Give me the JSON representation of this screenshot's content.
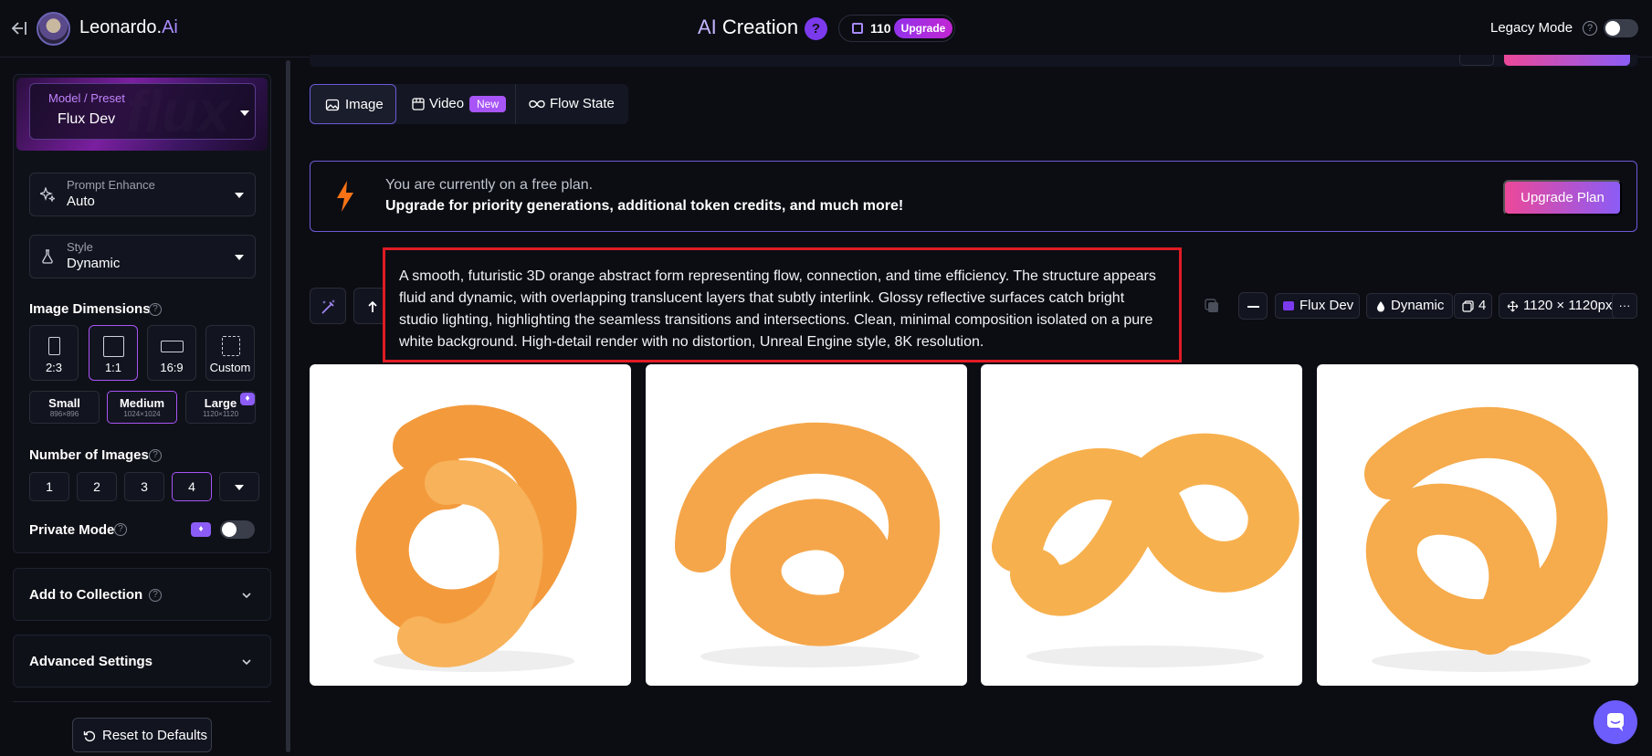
{
  "header": {
    "brand_name": "Leonardo.",
    "brand_ai": "Ai",
    "title_ai": "AI",
    "title_rest": " Creation",
    "help": "?",
    "token_count": "110",
    "upgrade_label": "Upgrade",
    "legacy_mode_label": "Legacy Mode",
    "legacy_help": "?"
  },
  "sidebar": {
    "model_label": "Model / Preset",
    "model_value": "Flux Dev",
    "model_ghost": "flux",
    "prompt_enhance_label": "Prompt Enhance",
    "prompt_enhance_value": "Auto",
    "style_label": "Style",
    "style_value": "Dynamic",
    "image_dimensions_title": "Image Dimensions",
    "help": "?",
    "ratios": [
      {
        "label": "2:3"
      },
      {
        "label": "1:1"
      },
      {
        "label": "16:9"
      },
      {
        "label": "Custom"
      }
    ],
    "sizes": [
      {
        "name": "Small",
        "dim": "896×896"
      },
      {
        "name": "Medium",
        "dim": "1024×1024"
      },
      {
        "name": "Large",
        "dim": "1120×1120"
      }
    ],
    "number_of_images_title": "Number of Images",
    "numbers": [
      "1",
      "2",
      "3",
      "4"
    ],
    "private_mode_label": "Private Mode",
    "add_to_collection_label": "Add to Collection",
    "advanced_settings_label": "Advanced Settings",
    "reset_label": "Reset to Defaults"
  },
  "tabs": {
    "image": "Image",
    "video": "Video",
    "video_badge": "New",
    "flow_state": "Flow State"
  },
  "banner": {
    "line1": "You are currently on a free plan.",
    "line2": "Upgrade for priority generations, additional token credits, and much more!",
    "button": "Upgrade Plan"
  },
  "generation": {
    "prompt": "A smooth, futuristic 3D orange abstract form representing flow, connection, and time efficiency. The structure appears fluid and dynamic, with overlapping translucent layers that subtly interlink. Glossy reflective surfaces catch bright studio lighting, highlighting the seamless transitions and intersections. Clean, minimal composition isolated on a pure white background. High-detail render with no distortion, Unreal Engine style, 8K resolution.",
    "chip_model": "Flux Dev",
    "chip_style": "Dynamic",
    "chip_count": "4",
    "chip_size": "1120 × 1120px",
    "more": "···"
  },
  "colors": {
    "accent": "#a855f7",
    "highlight_border": "#e01b24",
    "orange": "#f5a04a"
  }
}
